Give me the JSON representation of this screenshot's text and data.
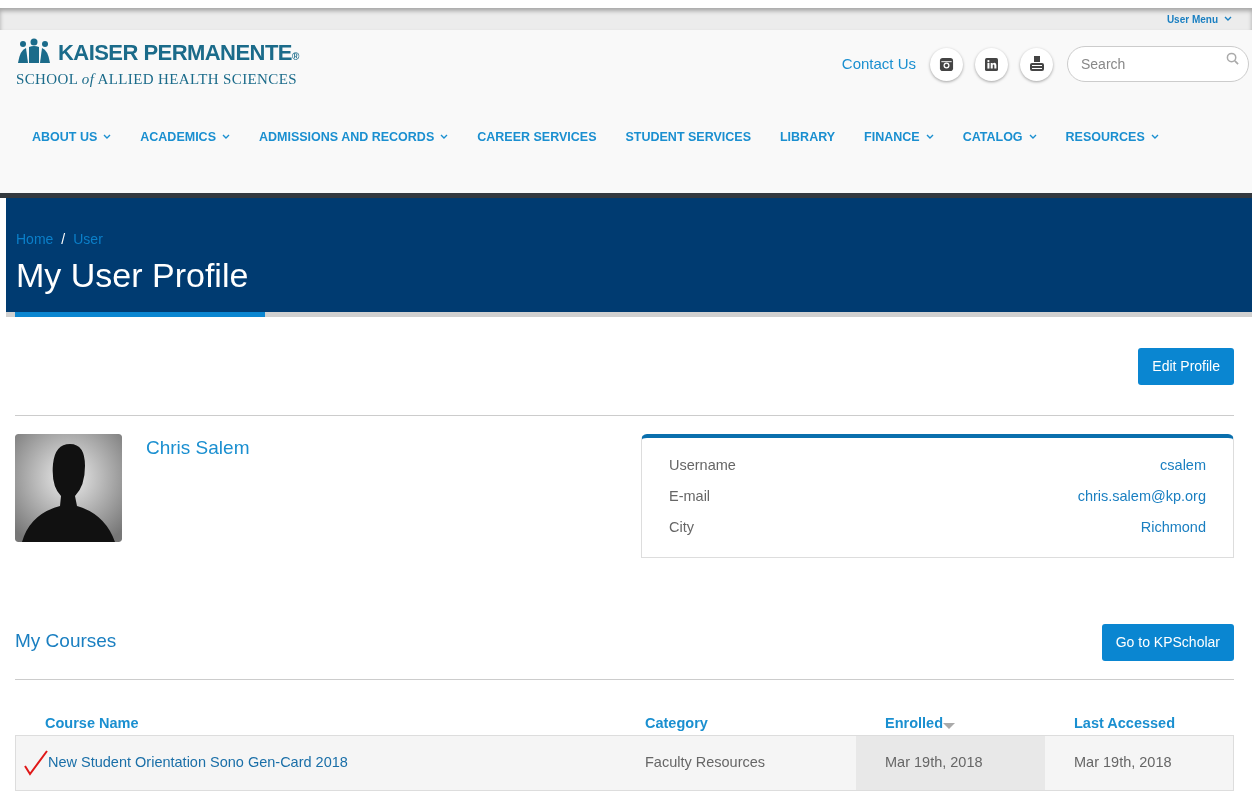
{
  "user_menu": "User Menu",
  "logo": {
    "name": "KAISER PERMANENTE",
    "registered": "®",
    "subtitle": "SCHOOL *of* ALLIED HEALTH SCIENCES"
  },
  "contact": "Contact Us",
  "search": {
    "placeholder": "Search"
  },
  "nav": [
    {
      "label": "ABOUT US",
      "dropdown": true
    },
    {
      "label": "ACADEMICS",
      "dropdown": true
    },
    {
      "label": "ADMISSIONS AND RECORDS",
      "dropdown": true
    },
    {
      "label": "CAREER SERVICES",
      "dropdown": false
    },
    {
      "label": "STUDENT SERVICES",
      "dropdown": false
    },
    {
      "label": "LIBRARY",
      "dropdown": false
    },
    {
      "label": "FINANCE",
      "dropdown": true
    },
    {
      "label": "CATALOG",
      "dropdown": true
    },
    {
      "label": "RESOURCES",
      "dropdown": true
    }
  ],
  "breadcrumb": {
    "separator": "/",
    "items": [
      "Home",
      "User"
    ]
  },
  "page_title": "My User Profile",
  "edit_button": "Edit Profile",
  "profile": {
    "name": "Chris Salem",
    "fields": [
      {
        "label": "Username",
        "value": "csalem"
      },
      {
        "label": "E-mail",
        "value": "chris.salem@kp.org"
      },
      {
        "label": "City",
        "value": "Richmond"
      }
    ]
  },
  "courses": {
    "title": "My Courses",
    "button": "Go to KPScholar",
    "columns": [
      {
        "label": "Course Name",
        "sorted": false
      },
      {
        "label": "Category",
        "sorted": false
      },
      {
        "label": "Enrolled",
        "sorted": true
      },
      {
        "label": "Last Accessed",
        "sorted": false
      }
    ],
    "rows": [
      {
        "completed": true,
        "cells": [
          "New Student Orientation Sono Gen-Card 2018",
          "Faculty Resources",
          "Mar 19th, 2018",
          "Mar 19th, 2018"
        ]
      }
    ]
  }
}
